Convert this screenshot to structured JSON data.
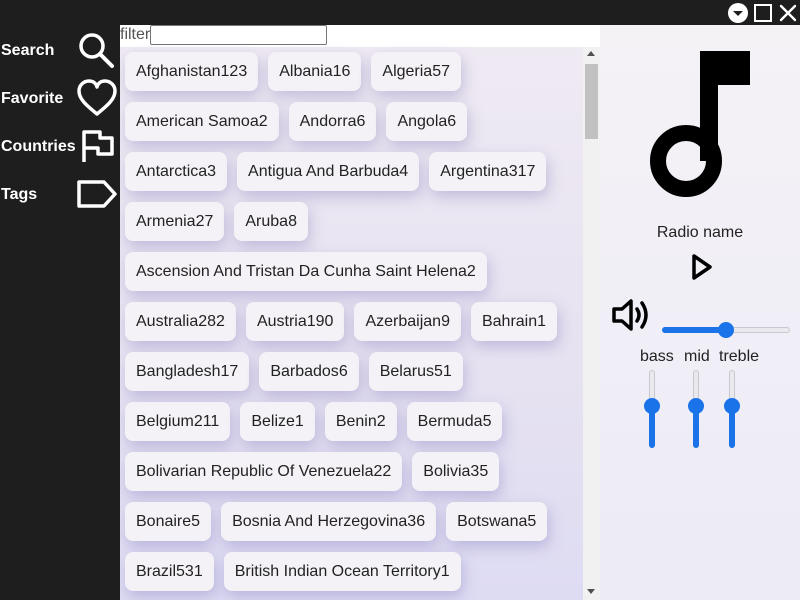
{
  "window_controls": {
    "icons": [
      "dropdown-circle-icon",
      "maximize-icon",
      "close-icon"
    ]
  },
  "sidebar": {
    "items": [
      {
        "label": "Search",
        "icon": "search-icon"
      },
      {
        "label": "Favorite",
        "icon": "heart-icon"
      },
      {
        "label": "Countries",
        "icon": "flag-icon"
      },
      {
        "label": "Tags",
        "icon": "tag-icon"
      }
    ]
  },
  "filter": {
    "label": "filter",
    "value": ""
  },
  "countries": [
    [
      {
        "name": "Afghanistan",
        "count": "123"
      },
      {
        "name": "Albania",
        "count": "16"
      },
      {
        "name": "Algeria",
        "count": "57"
      }
    ],
    [
      {
        "name": "American Samoa",
        "count": "2"
      },
      {
        "name": "Andorra",
        "count": "6"
      },
      {
        "name": "Angola",
        "count": "6"
      }
    ],
    [
      {
        "name": "Antarctica",
        "count": "3"
      },
      {
        "name": "Antigua And Barbuda",
        "count": "4"
      },
      {
        "name": "Argentina",
        "count": "317"
      }
    ],
    [
      {
        "name": "Armenia",
        "count": "27"
      },
      {
        "name": "Aruba",
        "count": "8"
      }
    ],
    [
      {
        "name": "Ascension And Tristan Da Cunha Saint Helena",
        "count": "2"
      }
    ],
    [
      {
        "name": "Australia",
        "count": "282"
      },
      {
        "name": "Austria",
        "count": "190"
      },
      {
        "name": "Azerbaijan",
        "count": "9"
      },
      {
        "name": "Bahrain",
        "count": "1"
      }
    ],
    [
      {
        "name": "Bangladesh",
        "count": "17"
      },
      {
        "name": "Barbados",
        "count": "6"
      },
      {
        "name": "Belarus",
        "count": "51"
      }
    ],
    [
      {
        "name": "Belgium",
        "count": "211"
      },
      {
        "name": "Belize",
        "count": "1"
      },
      {
        "name": "Benin",
        "count": "2"
      },
      {
        "name": "Bermuda",
        "count": "5"
      }
    ],
    [
      {
        "name": "Bolivarian Republic Of Venezuela",
        "count": "22"
      },
      {
        "name": "Bolivia",
        "count": "35"
      }
    ],
    [
      {
        "name": "Bonaire",
        "count": "5"
      },
      {
        "name": "Bosnia And Herzegovina",
        "count": "36"
      },
      {
        "name": "Botswana",
        "count": "5"
      }
    ],
    [
      {
        "name": "Brazil",
        "count": "531"
      },
      {
        "name": "British Indian Ocean Territory",
        "count": "1"
      }
    ]
  ],
  "player": {
    "cover_icon": "music-note-icon",
    "radio_name": "Radio name",
    "play_icon": "play-icon",
    "volume_icon": "speaker-icon",
    "volume": 0.5,
    "eq": [
      {
        "label": "bass",
        "value": 0.55
      },
      {
        "label": "mid",
        "value": 0.55
      },
      {
        "label": "treble",
        "value": 0.55
      }
    ],
    "accent": "#1a73e8"
  }
}
